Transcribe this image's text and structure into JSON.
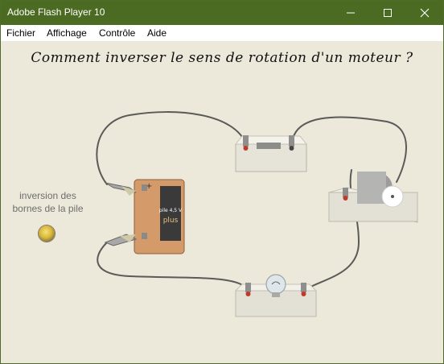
{
  "window": {
    "title": "Adobe Flash Player 10",
    "colors": {
      "titlebar": "#4c6b22",
      "stage": "#ece8da"
    }
  },
  "menu": {
    "items": [
      "Fichier",
      "Affichage",
      "Contrôle",
      "Aide"
    ]
  },
  "stage": {
    "title": "Comment inverser le sens de rotation d'un moteur ?",
    "reverse_label_line1": "inversion des",
    "reverse_label_line2": "bornes de la pile",
    "battery_label": "pile 4,5 V",
    "battery_brand": "plus",
    "battery_plus_sign": "+"
  }
}
